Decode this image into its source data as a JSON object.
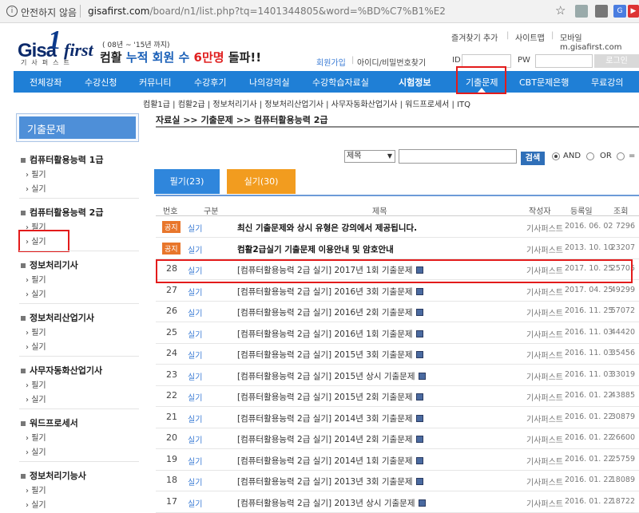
{
  "browser": {
    "security": "안전하지 않음",
    "url_host": "gisafirst.com",
    "url_path": "/board/n1/list.php?tq=1401344805&word=%BD%C7%B1%E2"
  },
  "logo": {
    "gisa": "Gisa",
    "one": "1",
    "first": "first",
    "sub": "기사퍼스트"
  },
  "promo": {
    "small": "( 08년 ~ '15년 까지)",
    "prefix": "컴활",
    "blue": "누적 회원 수",
    "red": "6만명",
    "suffix": "돌파!!"
  },
  "toplinks": [
    "즐겨찾기 추가",
    "사이트맵",
    "모바일 m.gisafirst.com"
  ],
  "login": {
    "join": "회원가입",
    "find": "아이디/비밀번호찾기",
    "id_label": "ID",
    "pw_label": "PW",
    "button": "로그인"
  },
  "nav": [
    "전체강좌",
    "수강신청",
    "커뮤니티",
    "수강후기",
    "나의강의실",
    "수강학습자료실",
    "시험정보",
    "기출문제",
    "CBT문제은행",
    "무료강의"
  ],
  "subnav": "컴활1급 | 컴활2급 | 정보처리기사 | 정보처리산업기사 | 사무자동화산업기사 | 워드프로세서 | ITQ",
  "sidebar": {
    "title": "기출문제",
    "categories": [
      {
        "name": "컴퓨터활용능력 1급",
        "subs": [
          "필기",
          "실기"
        ]
      },
      {
        "name": "컴퓨터활용능력 2급",
        "subs": [
          "필기",
          "실기"
        ]
      },
      {
        "name": "정보처리기사",
        "subs": [
          "필기",
          "실기"
        ]
      },
      {
        "name": "정보처리산업기사",
        "subs": [
          "필기",
          "실기"
        ]
      },
      {
        "name": "사무자동화산업기사",
        "subs": [
          "필기",
          "실기"
        ]
      },
      {
        "name": "워드프로세서",
        "subs": [
          "필기",
          "실기"
        ]
      },
      {
        "name": "정보처리기능사",
        "subs": [
          "필기",
          "실기"
        ]
      }
    ]
  },
  "breadcrumb": "자료실 >> 기출문제 >> 컴퓨터활용능력 2급",
  "search": {
    "field": "제목",
    "button": "검색",
    "and": "AND",
    "or": "OR",
    "eq": "="
  },
  "tabs": [
    "필기(23)",
    "실기(30)"
  ],
  "table": {
    "headers": [
      "번호",
      "구분",
      "제목",
      "작성자",
      "등록일",
      "조회"
    ],
    "rows": [
      {
        "no": "공지",
        "notice": true,
        "kind": "실기",
        "title": "최신 기출문제와 상시 유형은 강의에서 제공됩니다.",
        "author": "기사퍼스트",
        "date": "2016. 06. 02",
        "views": "7296"
      },
      {
        "no": "공지",
        "notice": true,
        "kind": "실기",
        "title": "컴활2급실기 기출문제 이용안내 및 암호안내",
        "author": "기사퍼스트",
        "date": "2013. 10. 10",
        "views": "23207"
      },
      {
        "no": "28",
        "kind": "실기",
        "title": "[컴퓨터활용능력 2급 실기] 2017년 1회 기출문제",
        "author": "기사퍼스트",
        "date": "2017. 10. 25",
        "views": "25705"
      },
      {
        "no": "27",
        "kind": "실기",
        "title": "[컴퓨터활용능력 2급 실기] 2016년 3회 기출문제",
        "author": "기사퍼스트",
        "date": "2017. 04. 25",
        "views": "49299"
      },
      {
        "no": "26",
        "kind": "실기",
        "title": "[컴퓨터활용능력 2급 실기] 2016년 2회 기출문제",
        "author": "기사퍼스트",
        "date": "2016. 11. 25",
        "views": "57072"
      },
      {
        "no": "25",
        "kind": "실기",
        "title": "[컴퓨터활용능력 2급 실기] 2016년 1회 기출문제",
        "author": "기사퍼스트",
        "date": "2016. 11. 03",
        "views": "44420"
      },
      {
        "no": "24",
        "kind": "실기",
        "title": "[컴퓨터활용능력 2급 실기] 2015년 3회 기출문제",
        "author": "기사퍼스트",
        "date": "2016. 11. 03",
        "views": "35456"
      },
      {
        "no": "23",
        "kind": "실기",
        "title": "[컴퓨터활용능력 2급 실기] 2015년 상시 기출문제",
        "author": "기사퍼스트",
        "date": "2016. 11. 03",
        "views": "33019"
      },
      {
        "no": "22",
        "kind": "실기",
        "title": "[컴퓨터활용능력 2급 실기] 2015년 2회 기출문제",
        "author": "기사퍼스트",
        "date": "2016. 01. 22",
        "views": "43885"
      },
      {
        "no": "21",
        "kind": "실기",
        "title": "[컴퓨터활용능력 2급 실기] 2014년 3회 기출문제",
        "author": "기사퍼스트",
        "date": "2016. 01. 22",
        "views": "30879"
      },
      {
        "no": "20",
        "kind": "실기",
        "title": "[컴퓨터활용능력 2급 실기] 2014년 2회 기출문제",
        "author": "기사퍼스트",
        "date": "2016. 01. 22",
        "views": "26600"
      },
      {
        "no": "19",
        "kind": "실기",
        "title": "[컴퓨터활용능력 2급 실기] 2014년 1회 기출문제",
        "author": "기사퍼스트",
        "date": "2016. 01. 22",
        "views": "25759"
      },
      {
        "no": "18",
        "kind": "실기",
        "title": "[컴퓨터활용능력 2급 실기] 2013년 3회 기출문제",
        "author": "기사퍼스트",
        "date": "2016. 01. 22",
        "views": "18089"
      },
      {
        "no": "17",
        "kind": "실기",
        "title": "[컴퓨터활용능력 2급 실기] 2013년 상시 기출문제",
        "author": "기사퍼스트",
        "date": "2016. 01. 22",
        "views": "18722"
      }
    ]
  },
  "colors": {
    "nav": "#1f7fd6",
    "tab_active": "#f29c1f",
    "tab_inactive": "#2f86dc",
    "highlight": "#e31b1b",
    "notice_badge": "#e8762b"
  }
}
